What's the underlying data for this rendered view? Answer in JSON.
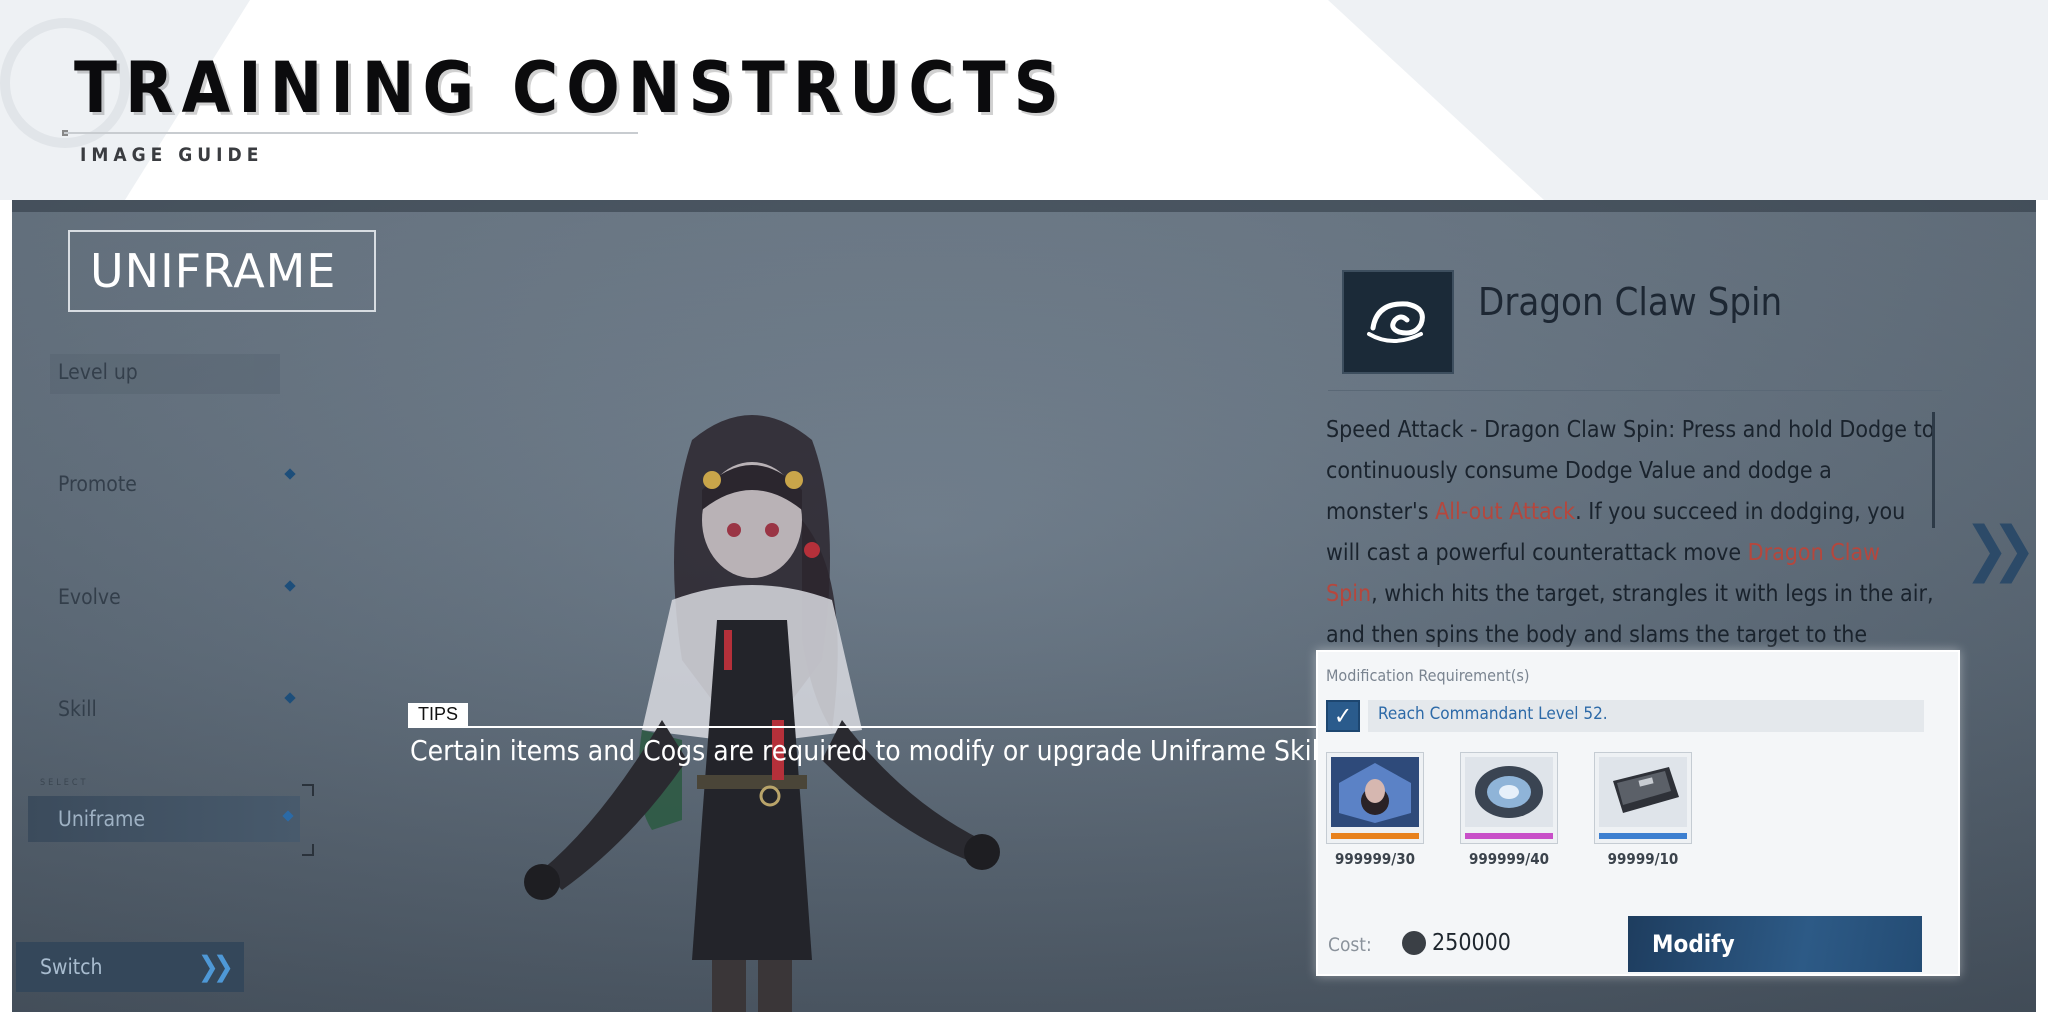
{
  "banner": {
    "title": "TRAINING CONSTRUCTS",
    "subtitle": "IMAGE GUIDE"
  },
  "menu": {
    "section_title": "UNIFRAME",
    "items": [
      {
        "label": "Level up"
      },
      {
        "label": "Promote"
      },
      {
        "label": "Evolve"
      },
      {
        "label": "Skill"
      }
    ],
    "select_tag": "SELECT",
    "selected": "Uniframe",
    "switch_label": "Switch"
  },
  "skill": {
    "name": "Dragon Claw Spin",
    "icon": "swirl-icon",
    "desc_parts": [
      {
        "text": "Speed Attack - Dragon Claw Spin: Press and hold Dodge to continuously consume Dodge Value and dodge a monster's ",
        "hl": false
      },
      {
        "text": "All-out Attack",
        "hl": true
      },
      {
        "text": ". If you succeed in dodging, you will cast a powerful counterattack move ",
        "hl": false
      },
      {
        "text": "Dragon Claw Spin",
        "hl": true
      },
      {
        "text": ", which hits the target, strangles it with legs in the air, and then spins the body and slams the target to the",
        "hl": false
      }
    ]
  },
  "tips": {
    "tag": "TIPS",
    "text": "Certain items and Cogs are required to modify or upgrade Uniframe Skills."
  },
  "modification": {
    "title": "Modification Requirement(s)",
    "requirement": "Reach Commandant Level 52.",
    "items": [
      {
        "count": "999999/30",
        "stripe": "#e8821e"
      },
      {
        "count": "999999/40",
        "stripe": "#c84fc8"
      },
      {
        "count": "99999/10",
        "stripe": "#3c7fd0"
      }
    ],
    "cost_label": "Cost:",
    "cost_value": "250000",
    "button_label": "Modify"
  }
}
